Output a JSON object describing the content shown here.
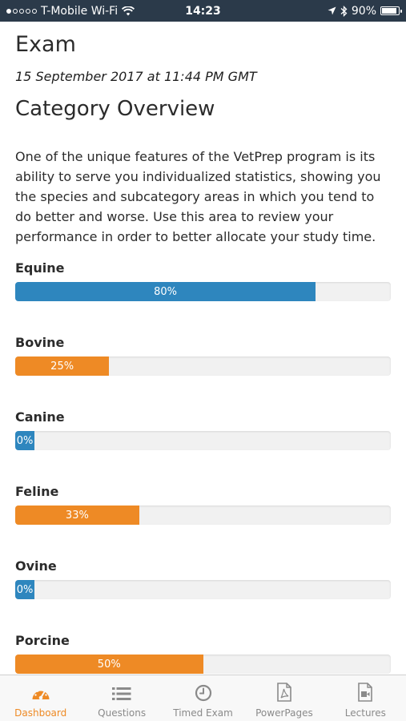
{
  "status_bar": {
    "carrier": "T-Mobile Wi-Fi",
    "time": "14:23",
    "battery": "90%",
    "battery_level": 0.9,
    "signal_dots_filled": 1,
    "signal_dots_total": 5,
    "icons": [
      "wifi-icon",
      "location-arrow-icon",
      "bluetooth-icon",
      "battery-icon"
    ]
  },
  "page": {
    "title": "Exam",
    "timestamp": "15 September 2017 at 11:44 PM GMT",
    "section_title": "Category Overview",
    "description": "One of the unique features of the VetPrep program is its ability to serve you individualized statistics, showing you the species and subcategory areas in which you tend to do better and worse. Use this area to review your performance in order to better allocate your study time."
  },
  "categories": [
    {
      "label": "Equine",
      "percent_label": "80%",
      "value": 80,
      "color": "#2e86be"
    },
    {
      "label": "Bovine",
      "percent_label": "25%",
      "value": 25,
      "color": "#ee8a25"
    },
    {
      "label": "Canine",
      "percent_label": "0%",
      "value": 0,
      "color": "#2e86be"
    },
    {
      "label": "Feline",
      "percent_label": "33%",
      "value": 33,
      "color": "#ee8a25"
    },
    {
      "label": "Ovine",
      "percent_label": "0%",
      "value": 0,
      "color": "#2e86be"
    },
    {
      "label": "Porcine",
      "percent_label": "50%",
      "value": 50,
      "color": "#ee8a25"
    }
  ],
  "tab_bar": {
    "active": "dashboard",
    "active_color": "#ee8a25",
    "inactive_color": "#8a8a8a",
    "tabs": [
      {
        "id": "dashboard",
        "label": "Dashboard",
        "icon": "dashboard-gauge-icon"
      },
      {
        "id": "questions",
        "label": "Questions",
        "icon": "list-icon"
      },
      {
        "id": "timed_exam",
        "label": "Timed Exam",
        "icon": "clock-icon"
      },
      {
        "id": "powerpages",
        "label": "PowerPages",
        "icon": "pdf-document-icon"
      },
      {
        "id": "lectures",
        "label": "Lectures",
        "icon": "video-file-icon"
      }
    ]
  }
}
